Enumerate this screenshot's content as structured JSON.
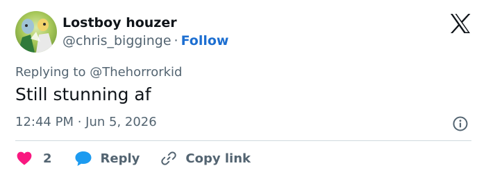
{
  "author": {
    "name": "Lostboy houzer",
    "handle": "@chris_bigginge",
    "separator": "·",
    "follow_label": "Follow"
  },
  "reply_context": {
    "prefix": "Replying to ",
    "mention": "@Thehorrorkid"
  },
  "tweet": {
    "text": "Still stunning af",
    "time": "12:44 PM · Jun 5, 2026"
  },
  "actions": {
    "like_count": "2",
    "reply_label": "Reply",
    "copy_label": "Copy link"
  },
  "icons": {
    "brand": "x-logo-icon",
    "info": "info-icon",
    "like": "heart-icon",
    "reply": "speech-bubble-icon",
    "copy": "link-icon"
  },
  "colors": {
    "like": "#f91880",
    "reply": "#1d9bf0",
    "follow": "#1d6fd1",
    "muted": "#536471",
    "text": "#0f1419"
  }
}
